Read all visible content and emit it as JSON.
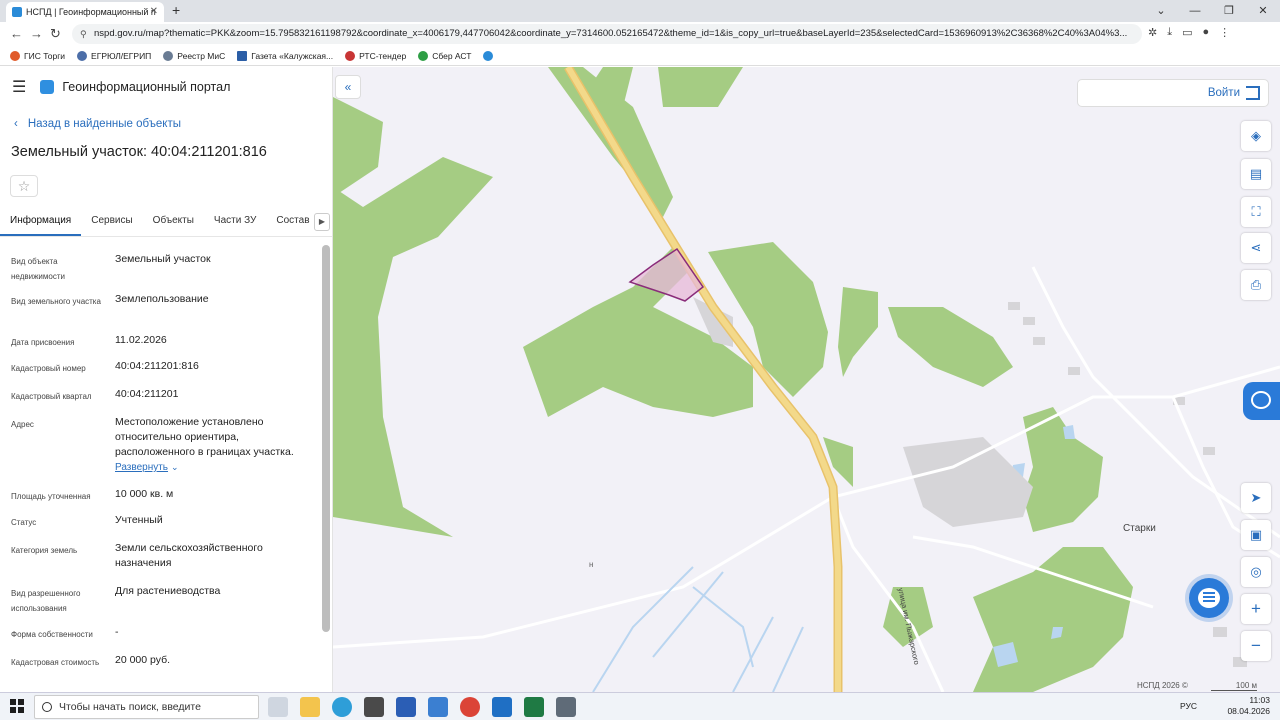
{
  "browser": {
    "tab_title": "НСПД | Геоинформационный п",
    "url": "nspd.gov.ru/map?thematic=PKK&zoom=15.795832161198792&coordinate_x=4006179,447706042&coordinate_y=7314600.052165472&theme_id=1&is_copy_url=true&baseLayerId=235&selectedCard=1536960913%2C36368%2C40%3A04%3...",
    "bookmarks": [
      "ГИС Торги",
      "ЕГРЮЛ/ЕГРИП",
      "Реестр МиС",
      "Газета «Калужская...",
      "РТС-тендер",
      "Сбер АСТ"
    ]
  },
  "portal": {
    "title": "Геоинформационный портал",
    "back_label": "Назад в найденные объекты",
    "object_title": "Земельный участок: 40:04:211201:816",
    "tabs": [
      "Информация",
      "Сервисы",
      "Объекты",
      "Части ЗУ",
      "Состав"
    ],
    "fields": [
      {
        "label": "Вид объекта недвижимости",
        "value": "Земельный участок"
      },
      {
        "label": "Вид земельного участка",
        "value": "Землепользование"
      },
      {
        "label": "Дата присвоения",
        "value": "11.02.2026"
      },
      {
        "label": "Кадастровый номер",
        "value": "40:04:211201:816"
      },
      {
        "label": "Кадастровый квартал",
        "value": "40:04:211201"
      },
      {
        "label": "Адрес",
        "value": "Местоположение установлено относительно ориентира, расположенного в границах участка."
      },
      {
        "label": "Площадь уточненная",
        "value": "10 000 кв. м"
      },
      {
        "label": "Статус",
        "value": "Учтенный"
      },
      {
        "label": "Категория земель",
        "value": "Земли сельскохозяйственного назначения"
      },
      {
        "label": "Вид разрешенного использования",
        "value": "Для растениеводства"
      },
      {
        "label": "Форма собственности",
        "value": "-"
      },
      {
        "label": "Кадастровая стоимость",
        "value": "20 000 руб."
      }
    ],
    "expand_label": "Развернуть"
  },
  "map": {
    "login_label": "Войти",
    "place_name": "Старки",
    "street_name": "улица им. Пыжарского",
    "copyright": "НСПД 2026 ©",
    "scale": "100 м",
    "n_mark": "н",
    "colors": {
      "forest": "#a5cc83",
      "road": "#f3d98a",
      "parcel_fill": "#e7b8d8",
      "parcel_stroke": "#8a2c7a",
      "water": "#b9d5f0"
    }
  },
  "taskbar": {
    "search_placeholder": "Чтобы начать поиск, введите",
    "language": "РУС",
    "time": "11:03",
    "date": "08.04.2026"
  }
}
